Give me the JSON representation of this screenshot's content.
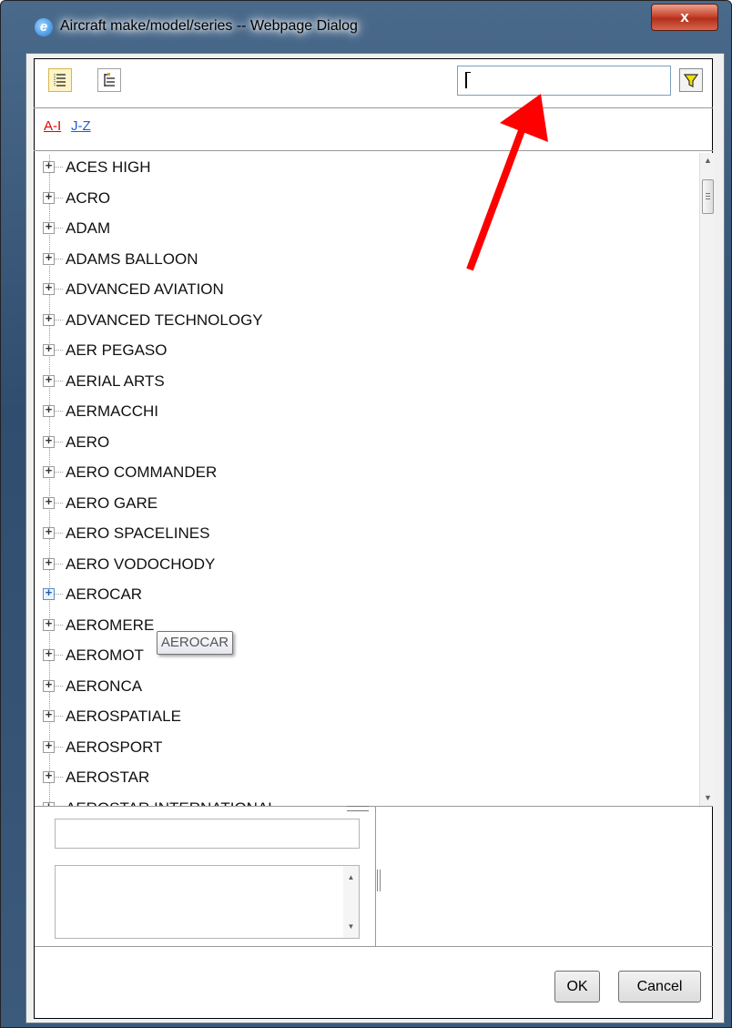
{
  "window": {
    "title": "Aircraft make/model/series -- Webpage Dialog",
    "close_label": "x",
    "app_icon_glyph": "e"
  },
  "toolbar": {
    "expand_all_icon": "list-view-icon",
    "collapse_icon": "tree-view-icon",
    "search_value": "",
    "filter_icon": "filter-funnel-icon",
    "filter_color": "#f2e200"
  },
  "alpha_filter": {
    "items": [
      {
        "label": "A-I",
        "color": "#e00000"
      },
      {
        "label": "J-Z",
        "color": "#1a5fd6"
      }
    ]
  },
  "tree": {
    "items": [
      "ACES HIGH",
      "ACRO",
      "ADAM",
      "ADAMS BALLOON",
      "ADVANCED AVIATION",
      "ADVANCED TECHNOLOGY",
      "AER PEGASO",
      "AERIAL ARTS",
      "AERMACCHI",
      "AERO",
      "AERO COMMANDER",
      "AERO GARE",
      "AERO SPACELINES",
      "AERO VODOCHODY",
      "AEROCAR",
      "AEROMERE",
      "AEROMOT",
      "AERONCA",
      "AEROSPATIALE",
      "AEROSPORT",
      "AEROSTAR",
      "AEROSTAR INTERNATIONAL"
    ],
    "expander_glyph": "+",
    "hovered_item": "AEROCAR",
    "tooltip": "AEROCAR"
  },
  "detail": {
    "field_value": "",
    "area_value": ""
  },
  "buttons": {
    "ok": "OK",
    "cancel": "Cancel"
  },
  "annotation": {
    "arrow_color": "#ff0000"
  }
}
